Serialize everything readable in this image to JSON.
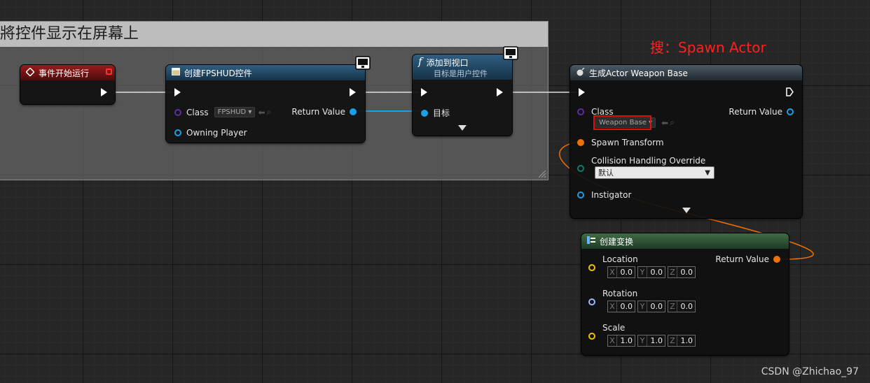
{
  "comment": {
    "title": "將控件显示在屏幕上"
  },
  "annotation": "搜：Spawn Actor",
  "watermark": "CSDN @Zhichao_97",
  "nodes": {
    "event_begin": {
      "title": "事件开始运行"
    },
    "create_widget": {
      "title": "创建FPSHUD控件",
      "class_label": "Class",
      "class_value": "FPSHUD",
      "owning_player": "Owning Player",
      "return_value": "Return Value"
    },
    "add_viewport": {
      "title": "添加到视口",
      "subtitle": "目标是用户控件",
      "target": "目标"
    },
    "spawn_actor": {
      "title": "生成Actor Weapon Base",
      "class_label": "Class",
      "class_value": "Weapon Base",
      "return_value": "Return Value",
      "spawn_transform": "Spawn Transform",
      "collision_label": "Collision Handling Override",
      "collision_value": "默认",
      "instigator": "Instigator"
    },
    "make_transform": {
      "title": "创建变换",
      "return_value": "Return Value",
      "location": {
        "label": "Location",
        "x": "0.0",
        "y": "0.0",
        "z": "0.0"
      },
      "rotation": {
        "label": "Rotation",
        "x": "0.0",
        "y": "0.0",
        "z": "0.0"
      },
      "scale": {
        "label": "Scale",
        "x": "1.0",
        "y": "1.0",
        "z": "1.0"
      }
    }
  },
  "axis_labels": {
    "x": "X",
    "y": "Y",
    "z": "Z"
  },
  "colors": {
    "exec": "#ffffff",
    "class_pin": "#5b2fa0",
    "object_pin": "#1aa0e6",
    "struct_pin": "#f07000",
    "enum_pin": "#0f7c6a",
    "vector_pin": "#f2c200",
    "rotator_pin": "#a0b4ff",
    "annotation": "#ff2020"
  }
}
